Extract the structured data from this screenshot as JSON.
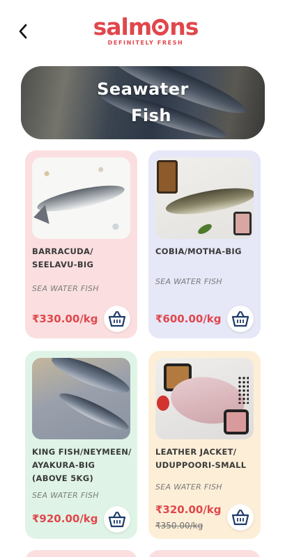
{
  "header": {
    "back_icon": "chevron-left-icon",
    "logo_text_before": "salm",
    "logo_text_after": "ns",
    "logo_tagline": "DEFINITELY FRESH"
  },
  "banner": {
    "title_line1": "Seawater",
    "title_line2": "Fish"
  },
  "colors": {
    "brand": "#e0474c",
    "card_pink": "#fbdfe0",
    "card_lavender": "#e6e7f7",
    "card_mint": "#dff4e6",
    "card_peach": "#fdefd7",
    "cart_icon": "#1d3a6b"
  },
  "products": [
    {
      "name": "BARRACUDA/ SEELAVU-BIG",
      "category": "SEA WATER FISH",
      "price": "₹330.00/kg",
      "cart_icon": "basket-icon"
    },
    {
      "name": "COBIA/MOTHA-BIG",
      "category": "SEA WATER FISH",
      "price": "₹600.00/kg",
      "cart_icon": "basket-icon"
    },
    {
      "name": "KING FISH/NEYMEEN/ AYAKURA-BIG (ABOVE 5KG)",
      "category": "SEA WATER FISH",
      "price": "₹920.00/kg",
      "cart_icon": "basket-icon"
    },
    {
      "name": "LEATHER JACKET/ UDUPPOORI-SMALL",
      "category": "SEA WATER FISH",
      "price": "₹320.00/kg",
      "old_price": "₹350.00/kg",
      "cart_icon": "basket-icon"
    }
  ]
}
